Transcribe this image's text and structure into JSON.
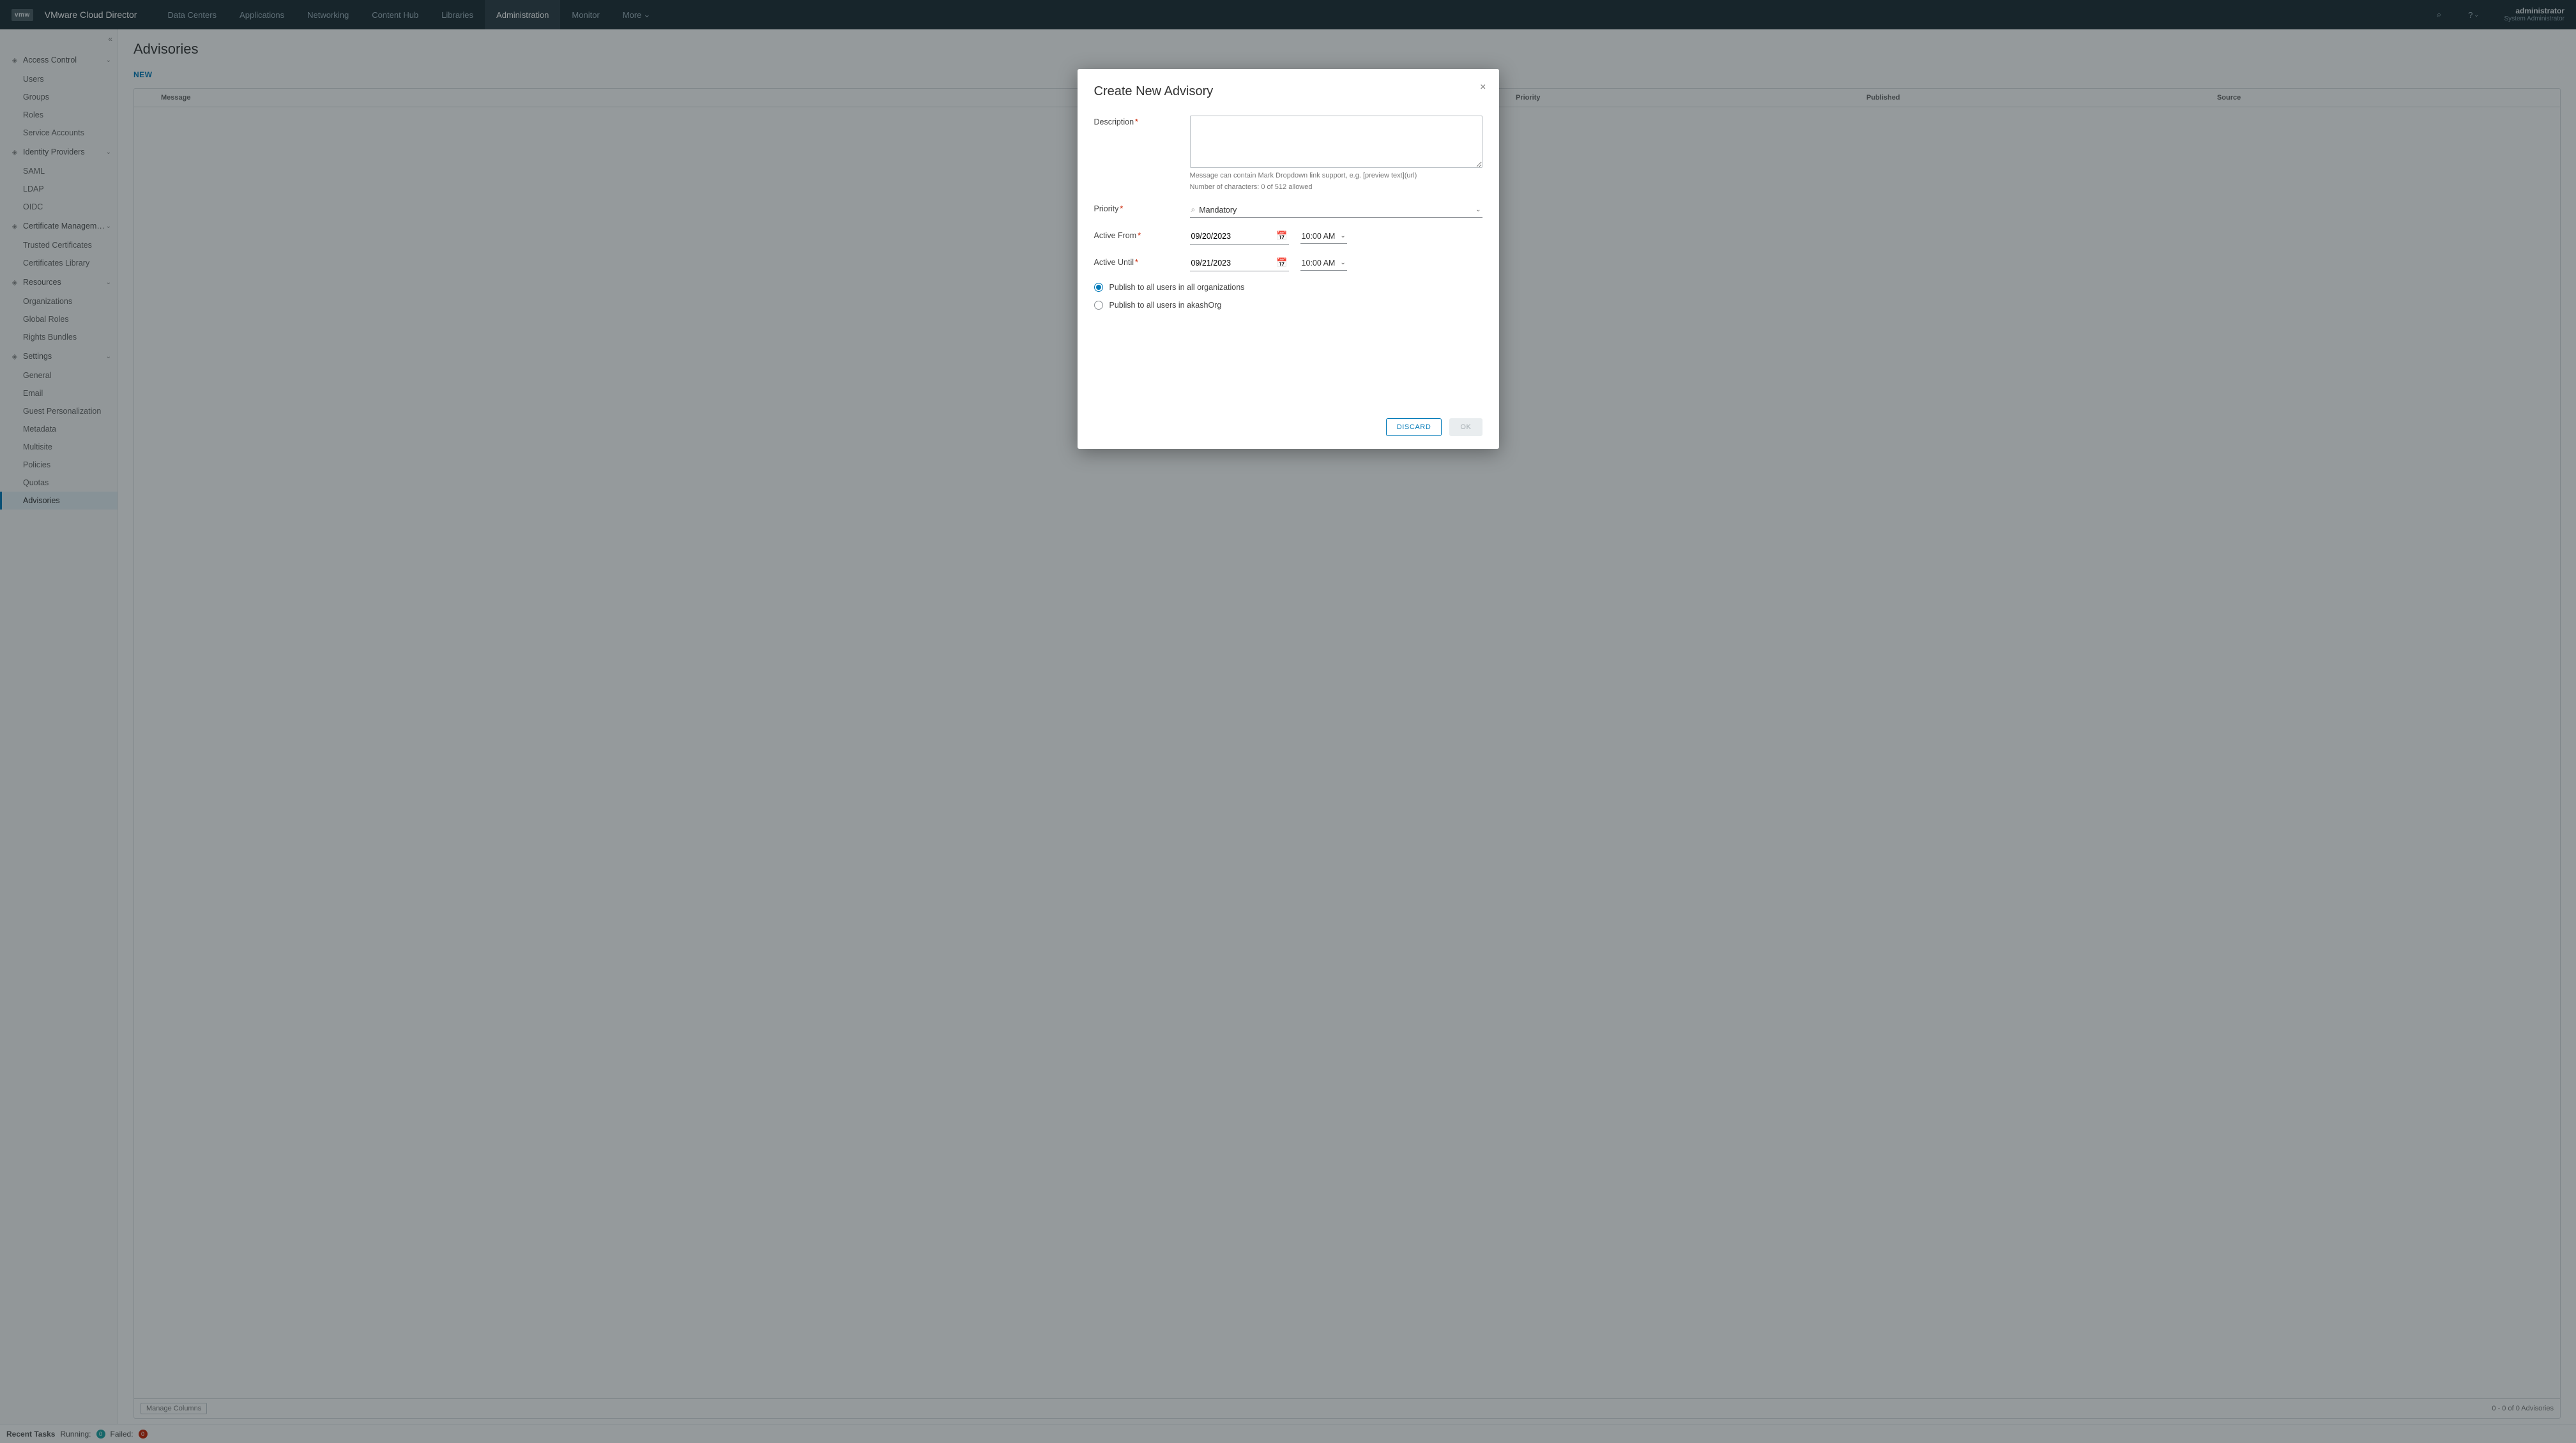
{
  "brand_logo_text": "vmw",
  "brand_title": "VMware Cloud Director",
  "top_tabs": [
    "Data Centers",
    "Applications",
    "Networking",
    "Content Hub",
    "Libraries",
    "Administration",
    "Monitor",
    "More"
  ],
  "top_tabs_active_index": 5,
  "more_caret": "⌄",
  "search_icon": "⌕",
  "help_icon": "?",
  "user_name": "administrator",
  "user_role": "System Administrator",
  "sidebar": {
    "collapse_icon": "«",
    "sections": [
      {
        "title": "Access Control",
        "items": [
          "Users",
          "Groups",
          "Roles",
          "Service Accounts"
        ]
      },
      {
        "title": "Identity Providers",
        "items": [
          "SAML",
          "LDAP",
          "OIDC"
        ]
      },
      {
        "title": "Certificate Managem…",
        "items": [
          "Trusted Certificates",
          "Certificates Library"
        ]
      },
      {
        "title": "Resources",
        "items": [
          "Organizations",
          "Global Roles",
          "Rights Bundles"
        ]
      },
      {
        "title": "Settings",
        "items": [
          "General",
          "Email",
          "Guest Personalization",
          "Metadata",
          "Multisite",
          "Policies",
          "Quotas",
          "Advisories"
        ],
        "selected_index": 7
      }
    ]
  },
  "page_title": "Advisories",
  "new_label": "NEW",
  "grid_columns": [
    "",
    "Message",
    "Priority",
    "Published",
    "Source"
  ],
  "manage_columns_label": "Manage Columns",
  "grid_footer_count": "0 - 0 of 0 Advisories",
  "recent": {
    "label": "Recent Tasks",
    "running_label": "Running:",
    "running_count": "0",
    "failed_label": "Failed:",
    "failed_count": "0"
  },
  "modal": {
    "title": "Create New Advisory",
    "close": "×",
    "description_label": "Description",
    "desc_hint1": "Message can contain Mark Dropdown link support, e.g. [preview text](url)",
    "desc_hint2": "Number of characters: 0 of 512 allowed",
    "priority_label": "Priority",
    "priority_value": "Mandatory",
    "active_from_label": "Active From",
    "active_from_date": "09/20/2023",
    "active_from_time": "10:00 AM",
    "active_until_label": "Active Until",
    "active_until_date": "09/21/2023",
    "active_until_time": "10:00 AM",
    "radio_all_orgs": "Publish to all users in all organizations",
    "radio_this_org": "Publish to all users in akashOrg",
    "discard": "DISCARD",
    "ok": "OK"
  }
}
